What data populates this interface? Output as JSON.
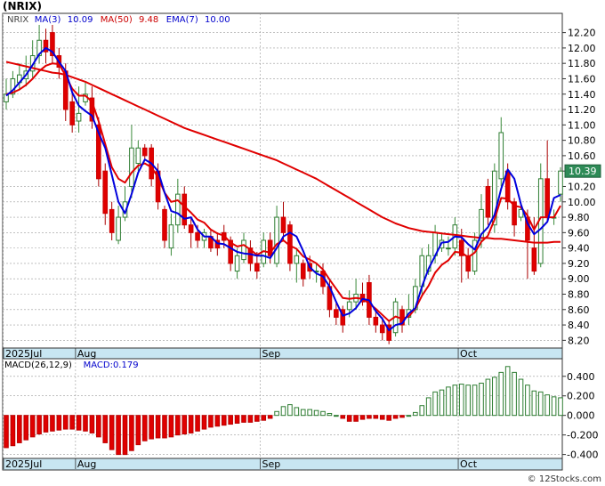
{
  "ticker_title": "(NRIX)",
  "watermark": "© 12Stocks.com",
  "chart_data": [
    {
      "type": "candlestick",
      "legend": [
        {
          "text": "NRIX",
          "color": "#444444"
        },
        {
          "text": "MA(3)",
          "color": "#0000cc"
        },
        {
          "text": "10.09",
          "color": "#0000cc"
        },
        {
          "text": "MA(50)",
          "color": "#cc0000"
        },
        {
          "text": "9.48",
          "color": "#cc0000"
        },
        {
          "text": "EMA(7)",
          "color": "#0000cc"
        },
        {
          "text": "10.00",
          "color": "#0000cc"
        }
      ],
      "last_price_label": "10.39",
      "ylim": [
        8.1,
        12.45
      ],
      "y_ticks": [
        "8.20",
        "8.40",
        "8.60",
        "8.80",
        "9.00",
        "9.20",
        "9.40",
        "9.60",
        "9.80",
        "10.00",
        "10.20",
        "10.40",
        "10.60",
        "10.80",
        "11.00",
        "11.20",
        "11.40",
        "11.60",
        "11.80",
        "12.00",
        "12.20"
      ],
      "x_labels": [
        {
          "text": "2025Jul",
          "index": 0
        },
        {
          "text": "Aug",
          "index": 11
        },
        {
          "text": "Sep",
          "index": 39
        },
        {
          "text": "Oct",
          "index": 69
        }
      ],
      "candles": [
        [
          11.3,
          11.4,
          11.6,
          11.2
        ],
        [
          11.4,
          11.6,
          11.7,
          11.35
        ],
        [
          11.55,
          11.65,
          11.8,
          11.45
        ],
        [
          11.6,
          11.7,
          11.9,
          11.5
        ],
        [
          11.7,
          11.9,
          12.1,
          11.6
        ],
        [
          11.9,
          12.1,
          12.3,
          11.8
        ],
        [
          12.1,
          11.95,
          12.25,
          11.8
        ],
        [
          12.2,
          11.9,
          12.3,
          11.8
        ],
        [
          11.9,
          11.75,
          12.0,
          11.6
        ],
        [
          11.7,
          11.2,
          11.8,
          11.05
        ],
        [
          11.3,
          11.0,
          11.4,
          10.9
        ],
        [
          11.05,
          11.15,
          11.5,
          10.9
        ],
        [
          11.3,
          11.4,
          11.55,
          11.25
        ],
        [
          11.35,
          11.05,
          11.5,
          10.95
        ],
        [
          11.0,
          10.3,
          11.1,
          10.2
        ],
        [
          10.4,
          9.85,
          10.5,
          9.7
        ],
        [
          9.9,
          9.6,
          10.0,
          9.5
        ],
        [
          9.5,
          9.8,
          9.95,
          9.45
        ],
        [
          9.8,
          10.0,
          10.2,
          9.75
        ],
        [
          10.2,
          10.7,
          11.0,
          10.05
        ],
        [
          10.5,
          10.7,
          10.8,
          10.4
        ],
        [
          10.7,
          10.6,
          10.75,
          10.55
        ],
        [
          10.7,
          10.3,
          10.75,
          10.2
        ],
        [
          10.4,
          10.0,
          10.5,
          9.9
        ],
        [
          9.9,
          9.5,
          9.95,
          9.4
        ],
        [
          9.4,
          9.7,
          9.85,
          9.3
        ],
        [
          9.7,
          10.1,
          10.3,
          9.6
        ],
        [
          10.1,
          9.7,
          10.2,
          9.65
        ],
        [
          9.7,
          9.6,
          9.8,
          9.4
        ],
        [
          9.6,
          9.5,
          9.7,
          9.4
        ],
        [
          9.5,
          9.6,
          9.65,
          9.4
        ],
        [
          9.55,
          9.4,
          9.65,
          9.35
        ],
        [
          9.5,
          9.4,
          9.6,
          9.3
        ],
        [
          9.6,
          9.5,
          9.7,
          9.4
        ],
        [
          9.5,
          9.2,
          9.55,
          9.1
        ],
        [
          9.1,
          9.3,
          9.4,
          9.0
        ],
        [
          9.25,
          9.5,
          9.6,
          9.2
        ],
        [
          9.4,
          9.2,
          9.5,
          9.1
        ],
        [
          9.2,
          9.1,
          9.35,
          9.0
        ],
        [
          9.2,
          9.5,
          9.6,
          9.15
        ],
        [
          9.5,
          9.3,
          9.6,
          9.2
        ],
        [
          9.2,
          9.8,
          9.95,
          9.15
        ],
        [
          9.8,
          9.6,
          10.0,
          9.5
        ],
        [
          9.7,
          9.2,
          9.75,
          9.1
        ],
        [
          9.2,
          9.3,
          9.4,
          8.95
        ],
        [
          9.2,
          9.0,
          9.25,
          8.9
        ],
        [
          9.2,
          9.1,
          9.3,
          9.0
        ],
        [
          9.1,
          9.1,
          9.2,
          8.95
        ],
        [
          9.1,
          8.9,
          9.2,
          8.8
        ],
        [
          8.9,
          8.6,
          9.0,
          8.5
        ],
        [
          8.6,
          8.5,
          8.7,
          8.4
        ],
        [
          8.6,
          8.4,
          8.65,
          8.3
        ],
        [
          8.6,
          8.7,
          8.85,
          8.5
        ],
        [
          8.7,
          8.8,
          9.0,
          8.6
        ],
        [
          8.8,
          8.7,
          8.95,
          8.65
        ],
        [
          8.95,
          8.5,
          9.05,
          8.4
        ],
        [
          8.5,
          8.4,
          8.6,
          8.3
        ],
        [
          8.4,
          8.3,
          8.5,
          8.2
        ],
        [
          8.4,
          8.2,
          8.45,
          8.15
        ],
        [
          8.3,
          8.7,
          8.75,
          8.25
        ],
        [
          8.6,
          8.4,
          8.65,
          8.3
        ],
        [
          8.5,
          8.6,
          8.8,
          8.4
        ],
        [
          8.6,
          8.9,
          9.0,
          8.55
        ],
        [
          8.9,
          9.3,
          9.4,
          8.8
        ],
        [
          9.1,
          9.3,
          9.45,
          9.05
        ],
        [
          9.3,
          9.6,
          9.7,
          9.2
        ],
        [
          9.4,
          9.5,
          9.6,
          9.35
        ],
        [
          9.4,
          9.4,
          9.55,
          9.3
        ],
        [
          9.4,
          9.7,
          9.8,
          9.3
        ],
        [
          9.5,
          9.3,
          9.65,
          8.95
        ],
        [
          9.3,
          9.1,
          9.4,
          9.0
        ],
        [
          9.1,
          9.5,
          9.6,
          9.05
        ],
        [
          9.5,
          9.9,
          10.1,
          9.4
        ],
        [
          10.2,
          9.8,
          10.3,
          9.7
        ],
        [
          9.7,
          10.4,
          10.5,
          9.6
        ],
        [
          10.3,
          10.9,
          11.1,
          10.2
        ],
        [
          10.4,
          10.0,
          10.5,
          9.9
        ],
        [
          10.0,
          9.7,
          10.05,
          9.55
        ],
        [
          9.8,
          9.9,
          10.0,
          9.75
        ],
        [
          9.8,
          9.5,
          9.9,
          9.0
        ],
        [
          9.4,
          9.1,
          9.8,
          9.05
        ],
        [
          9.2,
          10.3,
          10.5,
          9.15
        ],
        [
          10.3,
          9.8,
          10.8,
          9.75
        ],
        [
          9.8,
          9.8,
          9.9,
          9.7
        ],
        [
          10.1,
          10.4,
          10.45,
          10.0
        ]
      ],
      "ma3": [
        11.38,
        11.45,
        11.55,
        11.65,
        11.78,
        11.92,
        12.0,
        11.95,
        11.82,
        11.7,
        11.42,
        11.25,
        11.18,
        11.12,
        10.9,
        10.7,
        10.35,
        10.0,
        9.85,
        10.1,
        10.38,
        10.55,
        10.5,
        10.4,
        10.12,
        9.88,
        9.85,
        9.78,
        9.8,
        9.64,
        9.55,
        9.55,
        9.46,
        9.45,
        9.4,
        9.35,
        9.33,
        9.32,
        9.3,
        9.3,
        9.27,
        9.4,
        9.55,
        9.6,
        9.55,
        9.36,
        9.15,
        9.07,
        9.03,
        8.9,
        8.7,
        8.52,
        8.55,
        8.62,
        8.74,
        8.72,
        8.58,
        8.48,
        8.33,
        8.4,
        8.42,
        8.55,
        8.62,
        8.9,
        9.13,
        9.3,
        9.47,
        9.48,
        9.55,
        9.54,
        9.45,
        9.38,
        9.58,
        9.67,
        9.83,
        10.17,
        10.42,
        10.3,
        9.97,
        9.72,
        9.58,
        9.65,
        9.74,
        10.05,
        10.09
      ],
      "ema7": [
        11.4,
        11.42,
        11.46,
        11.52,
        11.6,
        11.7,
        11.77,
        11.8,
        11.79,
        11.64,
        11.47,
        11.38,
        11.38,
        11.3,
        11.05,
        10.75,
        10.45,
        10.3,
        10.25,
        10.38,
        10.47,
        10.5,
        10.45,
        10.32,
        10.12,
        10.0,
        10.02,
        9.94,
        9.86,
        9.77,
        9.73,
        9.64,
        9.59,
        9.56,
        9.47,
        9.42,
        9.44,
        9.38,
        9.31,
        9.36,
        9.34,
        9.45,
        9.5,
        9.43,
        9.39,
        9.29,
        9.25,
        9.2,
        9.12,
        8.99,
        8.87,
        8.75,
        8.74,
        8.75,
        8.74,
        8.68,
        8.61,
        8.53,
        8.45,
        8.51,
        8.48,
        8.51,
        8.61,
        8.78,
        8.91,
        9.08,
        9.18,
        9.24,
        9.35,
        9.34,
        9.28,
        9.34,
        9.48,
        9.56,
        9.77,
        10.05,
        10.04,
        9.95,
        9.93,
        9.82,
        9.64,
        9.8,
        9.8,
        9.8,
        9.95
      ],
      "ma50": [
        11.82,
        11.8,
        11.78,
        11.76,
        11.74,
        11.72,
        11.7,
        11.68,
        11.67,
        11.65,
        11.62,
        11.59,
        11.56,
        11.52,
        11.48,
        11.44,
        11.4,
        11.36,
        11.32,
        11.28,
        11.24,
        11.2,
        11.16,
        11.12,
        11.08,
        11.04,
        11.0,
        10.96,
        10.93,
        10.9,
        10.87,
        10.84,
        10.81,
        10.78,
        10.75,
        10.72,
        10.69,
        10.66,
        10.63,
        10.6,
        10.57,
        10.54,
        10.5,
        10.46,
        10.42,
        10.38,
        10.34,
        10.3,
        10.25,
        10.2,
        10.15,
        10.1,
        10.05,
        10.0,
        9.95,
        9.9,
        9.85,
        9.8,
        9.76,
        9.72,
        9.69,
        9.66,
        9.64,
        9.62,
        9.61,
        9.6,
        9.59,
        9.58,
        9.57,
        9.56,
        9.55,
        9.54,
        9.53,
        9.53,
        9.52,
        9.52,
        9.51,
        9.5,
        9.49,
        9.48,
        9.47,
        9.47,
        9.47,
        9.48,
        9.48
      ],
      "ma50_start_index": 0
    },
    {
      "type": "bar",
      "legend": [
        {
          "text": "MACD(26,12,9)",
          "color": "#000000"
        },
        {
          "text": "MACD:0.179",
          "color": "#0000cc"
        }
      ],
      "ylim": [
        -0.44,
        0.58
      ],
      "y_ticks": [
        "-0.400",
        "-0.200",
        "0.000",
        "0.200",
        "0.400"
      ],
      "x_labels": [
        {
          "text": "2025Jul",
          "index": 0
        },
        {
          "text": "Aug",
          "index": 11
        },
        {
          "text": "Sep",
          "index": 39
        },
        {
          "text": "Oct",
          "index": 69
        }
      ],
      "values": [
        -0.33,
        -0.31,
        -0.28,
        -0.25,
        -0.22,
        -0.19,
        -0.17,
        -0.16,
        -0.15,
        -0.14,
        -0.14,
        -0.15,
        -0.16,
        -0.18,
        -0.22,
        -0.28,
        -0.35,
        -0.4,
        -0.4,
        -0.36,
        -0.3,
        -0.26,
        -0.24,
        -0.23,
        -0.23,
        -0.22,
        -0.2,
        -0.19,
        -0.18,
        -0.16,
        -0.14,
        -0.12,
        -0.11,
        -0.1,
        -0.09,
        -0.08,
        -0.07,
        -0.07,
        -0.06,
        -0.05,
        -0.03,
        0.04,
        0.09,
        0.11,
        0.08,
        0.06,
        0.06,
        0.05,
        0.04,
        0.02,
        0.0,
        -0.03,
        -0.06,
        -0.06,
        -0.04,
        -0.03,
        -0.03,
        -0.04,
        -0.05,
        -0.03,
        -0.02,
        0.0,
        0.03,
        0.1,
        0.18,
        0.24,
        0.26,
        0.29,
        0.31,
        0.32,
        0.31,
        0.31,
        0.33,
        0.37,
        0.39,
        0.44,
        0.5,
        0.44,
        0.37,
        0.31,
        0.25,
        0.24,
        0.21,
        0.19,
        0.18
      ]
    }
  ]
}
